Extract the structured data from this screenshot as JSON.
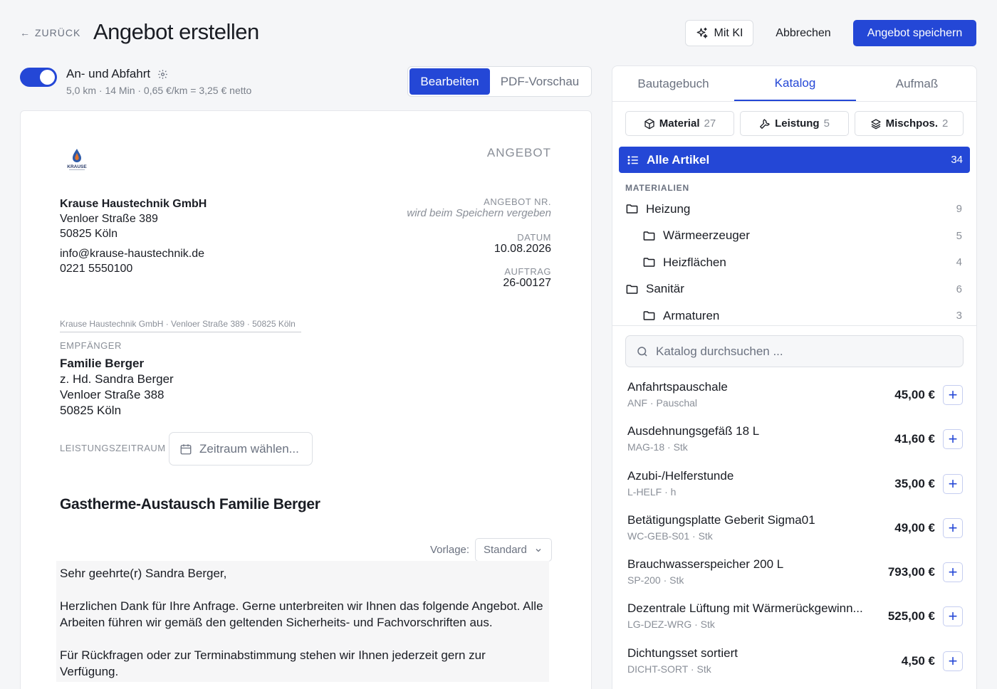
{
  "header": {
    "back_label": "ZURÜCK",
    "title": "Angebot erstellen",
    "ki_label": "Mit KI",
    "cancel_label": "Abbrechen",
    "save_label": "Angebot speichern"
  },
  "travel": {
    "enabled": true,
    "title": "An- und Abfahrt",
    "summary": "5,0 km · 14 Min · 0,65 €/km = 3,25 € netto"
  },
  "view_toggle": {
    "edit": "Bearbeiten",
    "preview": "PDF-Vorschau"
  },
  "document": {
    "logo_text": "KRAUSE",
    "doc_label": "ANGEBOT",
    "company": {
      "name": "Krause Haustechnik GmbH",
      "street": "Venloer Straße 389",
      "city": "50825 Köln",
      "email": "info@krause-haustechnik.de",
      "phone": "0221 5550100"
    },
    "meta": {
      "number_label": "ANGEBOT NR.",
      "number_value": "wird beim Speichern vergeben",
      "date_label": "DATUM",
      "date_value": "10.08.2026",
      "order_label": "AUFTRAG",
      "order_value": "26-00127"
    },
    "sender_line": "Krause Haustechnik GmbH · Venloer Straße 389 · 50825 Köln",
    "recipient_label": "EMPFÄNGER",
    "recipient": {
      "name": "Familie Berger",
      "attn": "z. Hd. Sandra Berger",
      "street": "Venloer Straße 388",
      "city": "50825 Köln"
    },
    "period_label": "LEISTUNGSZEITRAUM",
    "period_placeholder": "Zeitraum wählen...",
    "title": "Gastherme-Austausch Familie Berger",
    "template_label": "Vorlage:",
    "template_value": "Standard",
    "letter": {
      "greeting": "Sehr geehrte(r) Sandra Berger,",
      "p1": "Herzlichen Dank für Ihre Anfrage. Gerne unterbreiten wir Ihnen das folgende Angebot. Alle Arbeiten führen wir gemäß den geltenden Sicherheits- und Fachvorschriften aus.",
      "p2": "Für Rückfragen oder zur Terminabstimmung stehen wir Ihnen jederzeit gern zur Verfügung."
    }
  },
  "panel": {
    "tabs": [
      "Bautagebuch",
      "Katalog",
      "Aufmaß"
    ],
    "active_tab": "Katalog",
    "chips": [
      {
        "label": "Material",
        "count": "27"
      },
      {
        "label": "Leistung",
        "count": "5"
      },
      {
        "label": "Mischpos.",
        "count": "2"
      }
    ],
    "all": {
      "label": "Alle Artikel",
      "count": "34"
    },
    "section_label": "MATERIALIEN",
    "tree": [
      {
        "label": "Heizung",
        "count": "9"
      },
      {
        "label": "Wärmeerzeuger",
        "count": "5"
      },
      {
        "label": "Heizflächen",
        "count": "4"
      },
      {
        "label": "Sanitär",
        "count": "6"
      },
      {
        "label": "Armaturen",
        "count": "3"
      }
    ],
    "search_placeholder": "Katalog durchsuchen ...",
    "items": [
      {
        "name": "Anfahrtspauschale",
        "code": "ANF · Pauschal",
        "price": "45,00 €"
      },
      {
        "name": "Ausdehnungsgefäß 18 L",
        "code": "MAG-18 · Stk",
        "price": "41,60 €"
      },
      {
        "name": "Azubi-/Helferstunde",
        "code": "L-HELF · h",
        "price": "35,00 €"
      },
      {
        "name": "Betätigungsplatte Geberit Sigma01",
        "code": "WC-GEB-S01 · Stk",
        "price": "49,00 €"
      },
      {
        "name": "Brauchwasserspeicher 200 L",
        "code": "SP-200 · Stk",
        "price": "793,00 €"
      },
      {
        "name": "Dezentrale Lüftung mit Wärmerückgewinn...",
        "code": "LG-DEZ-WRG · Stk",
        "price": "525,00 €"
      },
      {
        "name": "Dichtungsset sortiert",
        "code": "DICHT-SORT · Stk",
        "price": "4,50 €"
      }
    ]
  }
}
